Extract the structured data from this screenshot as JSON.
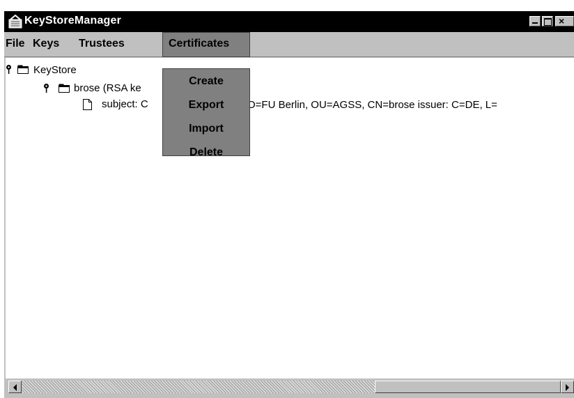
{
  "window": {
    "title": "KeyStoreManager",
    "controls": {
      "minimize": "minimize",
      "maximize": "maximize",
      "close": "×"
    }
  },
  "menubar": {
    "items": [
      {
        "label": "File"
      },
      {
        "label": "Keys"
      },
      {
        "label": "Trustees"
      },
      {
        "label": "Certificates",
        "open": true
      }
    ]
  },
  "certificates_menu": {
    "items": [
      {
        "label": "Create"
      },
      {
        "label": "Export"
      },
      {
        "label": "Import"
      },
      {
        "label": "Delete"
      }
    ]
  },
  "tree": {
    "root": {
      "label": "KeyStore",
      "icon": "folder-icon",
      "expanded": true
    },
    "child": {
      "label": "brose (RSA ke",
      "icon": "folder-icon",
      "expanded": true
    },
    "leaf": {
      "label_left": "subject: C",
      "label_right": "O=FU Berlin, OU=AGSS, CN=brose issuer: C=DE, L=",
      "icon": "document-icon"
    }
  },
  "scrollbar": {
    "orientation": "horizontal",
    "position": 0.68
  },
  "colors": {
    "titlebar": "#000000",
    "chrome": "#c0c0c0",
    "menu_highlight": "#808080",
    "content": "#ffffff"
  }
}
